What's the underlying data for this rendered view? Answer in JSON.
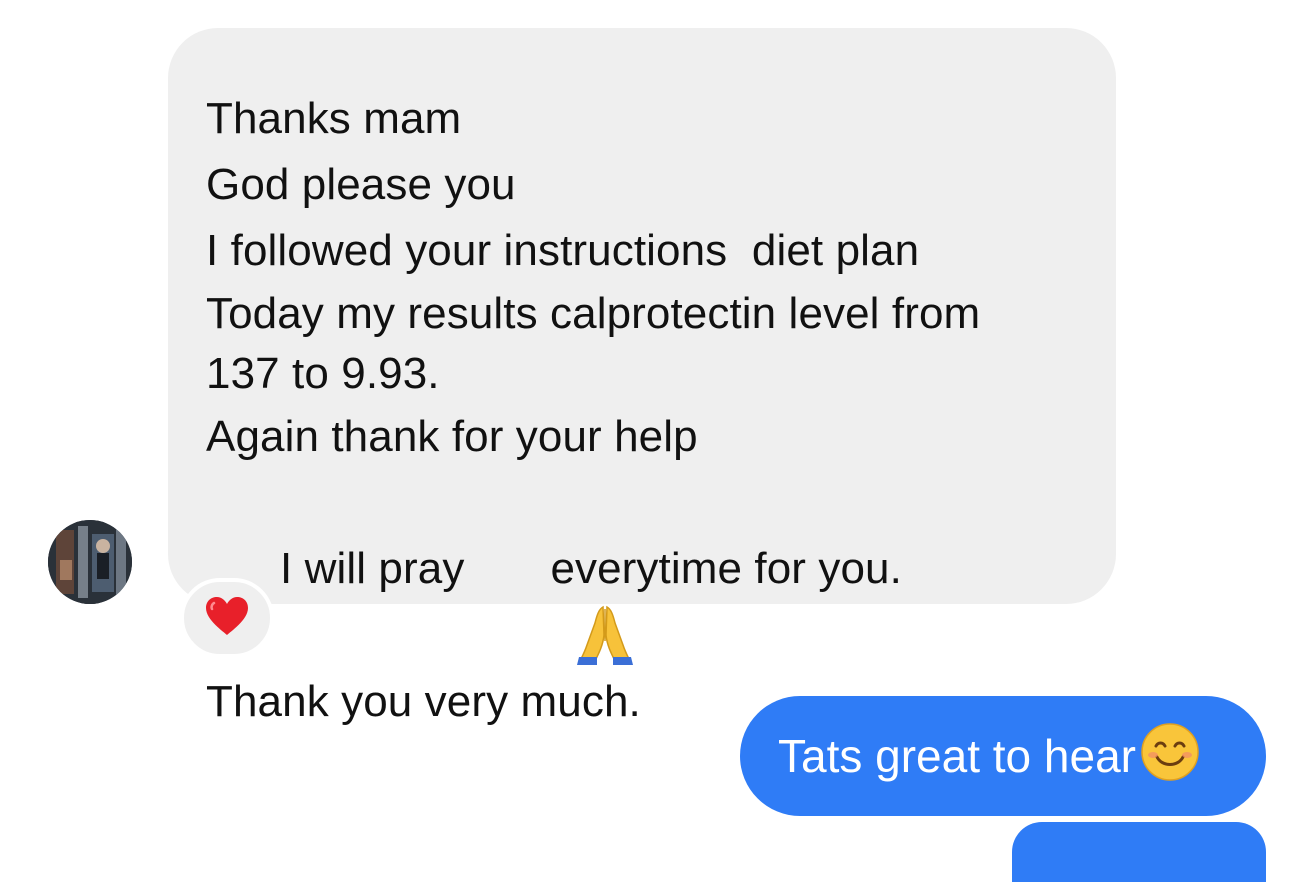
{
  "incoming_message": {
    "lines": [
      "Thanks mam",
      "God please you",
      "I followed your instructions  diet plan",
      "Today my results calprotectin level from",
      "137 to 9.93.",
      "Again thank for your help",
      "I will pray",
      "everytime for you.",
      "Thank you very much."
    ],
    "inline_emoji": "folded-hands-emoji",
    "reaction": "red-heart-emoji"
  },
  "outgoing_message": {
    "text": "Tats great to hear",
    "emoji": "smiling-face-emoji"
  },
  "colors": {
    "incoming_bubble": "#efefef",
    "outgoing_bubble": "#2f7cf6",
    "text_dark": "#111111",
    "text_light": "#ffffff"
  }
}
